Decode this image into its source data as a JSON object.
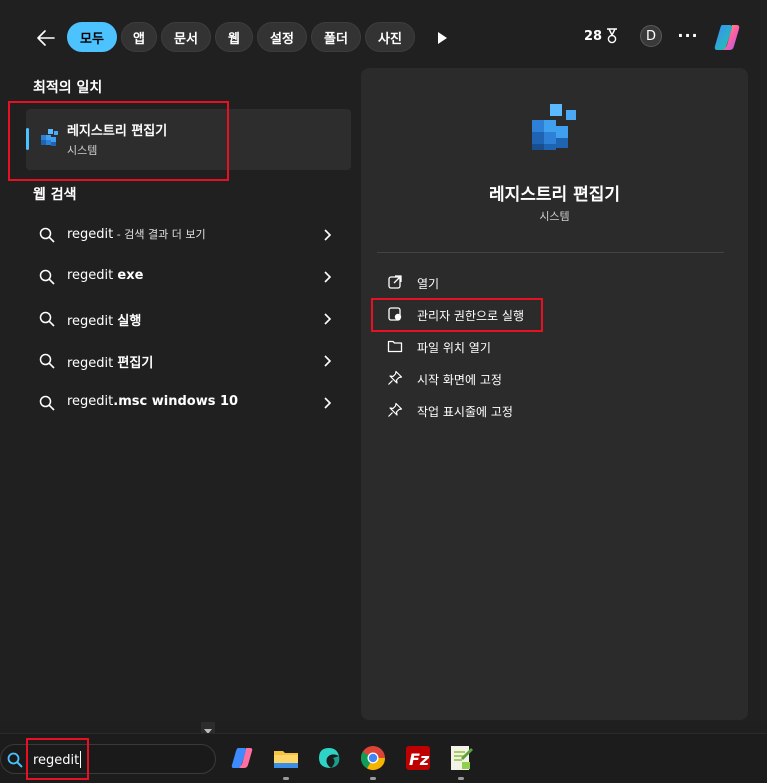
{
  "filters": {
    "chips": [
      "모두",
      "앱",
      "문서",
      "웹",
      "설정",
      "폴더",
      "사진"
    ],
    "active": "모두",
    "points": "28",
    "avatar_letter": "D",
    "more": "···"
  },
  "best_match": {
    "heading": "최적의 일치",
    "name": "레지스트리 편집기",
    "type": "시스템"
  },
  "web_search": {
    "heading": "웹 검색",
    "items": [
      {
        "query": "regedit",
        "extra": " - 검색 결과 더 보기"
      },
      {
        "query": "regedit ",
        "extra": "exe"
      },
      {
        "query": "regedit ",
        "extra": "실행"
      },
      {
        "query": "regedit ",
        "extra": "편집기"
      },
      {
        "query": "regedit",
        "extra": ".msc windows 10"
      }
    ]
  },
  "detail": {
    "title": "레지스트리 편집기",
    "subtitle": "시스템",
    "actions": [
      {
        "label": "열기",
        "icon": "open-external-icon"
      },
      {
        "label": "관리자 권한으로 실행",
        "icon": "admin-shield-icon"
      },
      {
        "label": "파일 위치 열기",
        "icon": "folder-icon"
      },
      {
        "label": "시작 화면에 고정",
        "icon": "pin-icon"
      },
      {
        "label": "작업 표시줄에 고정",
        "icon": "pin-icon"
      }
    ]
  },
  "taskbar": {
    "search_value": "regedit",
    "apps": [
      "copilot",
      "file-explorer",
      "edge-like-app",
      "chrome",
      "filezilla",
      "notepad-plus"
    ]
  },
  "colors": {
    "accent": "#4cc2ff",
    "highlight_box": "#e81123"
  }
}
